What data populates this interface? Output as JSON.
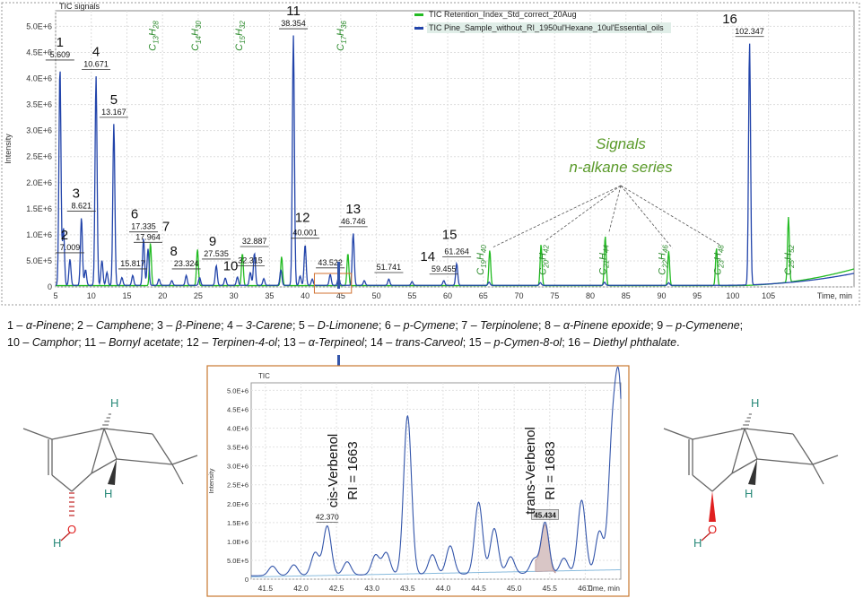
{
  "chart_data": [
    {
      "type": "line",
      "title": "TIC signals",
      "xlabel": "Time, min",
      "ylabel": "Intensity",
      "xlim": [
        5,
        117
      ],
      "ylim": [
        0,
        5300000
      ],
      "x_ticks": [
        "5",
        "10",
        "15",
        "20",
        "25",
        "30",
        "35",
        "40",
        "45",
        "50",
        "55",
        "60",
        "65",
        "70",
        "75",
        "80",
        "85",
        "90",
        "95",
        "100",
        "105"
      ],
      "y_ticks": [
        "0",
        "5.0E+5",
        "1.0E+6",
        "1.5E+6",
        "2.0E+6",
        "2.5E+6",
        "3.0E+6",
        "3.5E+6",
        "4.0E+6",
        "4.5E+6",
        "5.0E+6"
      ],
      "legend": {
        "position": "top-right",
        "entries": [
          {
            "name": "TIC Retention_Index_Std_correct_20Aug",
            "color": "#22bb22"
          },
          {
            "name": "TIC Pine_Sample_without_RI_1950ul'Hexane_10ul'Essential_oils",
            "color": "#2244aa"
          }
        ]
      },
      "series": [
        {
          "name": "TIC Pine_Sample_without_RI_1950ul'Hexane_10ul'Essential_oils",
          "color": "#2244aa",
          "peaks": [
            {
              "x": 5.609,
              "y": 4200000,
              "rt": "5.609",
              "num": "1"
            },
            {
              "x": 7.009,
              "y": 500000,
              "rt": "7.009",
              "num": "2"
            },
            {
              "x": 8.621,
              "y": 1300000,
              "rt": "8.621",
              "num": "3"
            },
            {
              "x": 10.671,
              "y": 4020000,
              "rt": "10.671",
              "num": "4"
            },
            {
              "x": 13.167,
              "y": 3100000,
              "rt": "13.167",
              "num": "5"
            },
            {
              "x": 15.817,
              "y": 190000,
              "rt": "15.817",
              "num": ""
            },
            {
              "x": 17.335,
              "y": 900000,
              "rt": "17.335",
              "num": "6"
            },
            {
              "x": 17.964,
              "y": 700000,
              "rt": "17.964",
              "num": "7"
            },
            {
              "x": 23.324,
              "y": 190000,
              "rt": "23.324",
              "num": "8"
            },
            {
              "x": 27.535,
              "y": 380000,
              "rt": "27.535",
              "num": "9"
            },
            {
              "x": 32.315,
              "y": 250000,
              "rt": "32.315",
              "num": "10"
            },
            {
              "x": 32.887,
              "y": 620000,
              "rt": "32.887",
              "num": ""
            },
            {
              "x": 38.354,
              "y": 4800000,
              "rt": "38.354",
              "num": "11"
            },
            {
              "x": 40.001,
              "y": 780000,
              "rt": "40.001",
              "num": "12"
            },
            {
              "x": 43.522,
              "y": 210000,
              "rt": "43.522",
              "num": ""
            },
            {
              "x": 46.746,
              "y": 1000000,
              "rt": "46.746",
              "num": "13"
            },
            {
              "x": 51.741,
              "y": 120000,
              "rt": "51.741",
              "num": ""
            },
            {
              "x": 59.455,
              "y": 90000,
              "rt": "59.455",
              "num": "14"
            },
            {
              "x": 61.264,
              "y": 420000,
              "rt": "61.264",
              "num": "15"
            },
            {
              "x": 102.347,
              "y": 4650000,
              "rt": "102.347",
              "num": "16"
            }
          ],
          "minor_peaks": [
            {
              "x": 6.1,
              "y": 1100000
            },
            {
              "x": 9.2,
              "y": 300000
            },
            {
              "x": 11.5,
              "y": 480000
            },
            {
              "x": 12.2,
              "y": 250000
            },
            {
              "x": 14.3,
              "y": 150000
            },
            {
              "x": 19.5,
              "y": 120000
            },
            {
              "x": 21.3,
              "y": 90000
            },
            {
              "x": 25.2,
              "y": 150000
            },
            {
              "x": 28.8,
              "y": 140000
            },
            {
              "x": 30.5,
              "y": 160000
            },
            {
              "x": 34.2,
              "y": 130000
            },
            {
              "x": 36.6,
              "y": 300000
            },
            {
              "x": 39.3,
              "y": 180000
            },
            {
              "x": 41.0,
              "y": 120000
            },
            {
              "x": 44.7,
              "y": 160000
            },
            {
              "x": 48.3,
              "y": 90000
            },
            {
              "x": 55.0,
              "y": 70000
            },
            {
              "x": 65.8,
              "y": 60000
            },
            {
              "x": 73.0,
              "y": 50000
            },
            {
              "x": 82.0,
              "y": 60000
            },
            {
              "x": 91.0,
              "y": 50000
            }
          ]
        },
        {
          "name": "TIC Retention_Index_Std_correct_20Aug",
          "color": "#22bb22",
          "peaks": [
            {
              "x": 18.3,
              "y": 820000
            },
            {
              "x": 24.9,
              "y": 700000
            },
            {
              "x": 31.2,
              "y": 620000
            },
            {
              "x": 36.7,
              "y": 560000
            },
            {
              "x": 46.0,
              "y": 620000
            },
            {
              "x": 65.9,
              "y": 680000
            },
            {
              "x": 73.1,
              "y": 790000
            },
            {
              "x": 82.1,
              "y": 950000
            },
            {
              "x": 91.0,
              "y": 660000
            },
            {
              "x": 97.7,
              "y": 720000
            },
            {
              "x": 107.8,
              "y": 1250000
            }
          ]
        }
      ],
      "alkane_labels": [
        {
          "x": 19.0,
          "text": "C13H28"
        },
        {
          "x": 25.0,
          "text": "C14H30"
        },
        {
          "x": 31.2,
          "text": "C15H32"
        },
        {
          "x": 45.4,
          "text": "C17H36"
        },
        {
          "x": 65.0,
          "text": "C19H40"
        },
        {
          "x": 73.8,
          "text": "C20H42"
        },
        {
          "x": 82.2,
          "text": "C21H44"
        },
        {
          "x": 90.5,
          "text": "C22H46"
        },
        {
          "x": 98.3,
          "text": "C23H48"
        },
        {
          "x": 108.2,
          "text": "C25H52"
        }
      ],
      "annotation": {
        "line1": "Signals",
        "line2": "n-alkane series"
      }
    },
    {
      "type": "line",
      "title": "TIC",
      "xlabel": "Time, min",
      "ylabel": "Intensity",
      "xlim": [
        41.3,
        46.5
      ],
      "ylim": [
        0,
        5200000
      ],
      "x_ticks": [
        "41.5",
        "42.0",
        "42.5",
        "43.0",
        "43.5",
        "44.0",
        "44.5",
        "45.0",
        "45.5",
        "46.0"
      ],
      "y_ticks": [
        "0",
        "5.0E+5",
        "1.0E+6",
        "1.5E+6",
        "2.0E+6",
        "2.5E+6",
        "3.0E+6",
        "3.5E+6",
        "4.0E+6",
        "4.5E+6",
        "5.0E+6"
      ],
      "peaks": [
        {
          "x": 41.6,
          "y": 250000
        },
        {
          "x": 41.9,
          "y": 280000
        },
        {
          "x": 42.2,
          "y": 600000
        },
        {
          "x": 42.37,
          "y": 1300000,
          "rt": "42.370"
        },
        {
          "x": 42.65,
          "y": 350000
        },
        {
          "x": 43.05,
          "y": 520000
        },
        {
          "x": 43.2,
          "y": 580000
        },
        {
          "x": 43.5,
          "y": 4200000
        },
        {
          "x": 43.85,
          "y": 520000
        },
        {
          "x": 44.1,
          "y": 750000
        },
        {
          "x": 44.5,
          "y": 1900000
        },
        {
          "x": 44.72,
          "y": 1200000
        },
        {
          "x": 44.95,
          "y": 450000
        },
        {
          "x": 45.28,
          "y": 380000
        },
        {
          "x": 45.434,
          "y": 1350000,
          "rt": "45.434"
        },
        {
          "x": 45.7,
          "y": 400000
        },
        {
          "x": 45.95,
          "y": 1930000
        },
        {
          "x": 46.2,
          "y": 1100000
        },
        {
          "x": 46.38,
          "y": 3300000
        },
        {
          "x": 46.48,
          "y": 4600000
        }
      ],
      "callouts": [
        {
          "name": "cis-Verbenol",
          "ri": "RI = 1663",
          "x": 42.37
        },
        {
          "name": "trans-Verbenol",
          "ri": "RI = 1683",
          "x": 45.434
        }
      ]
    }
  ],
  "caption": {
    "parts": [
      {
        "t": "1 – ",
        "i": false
      },
      {
        "t": "α-Pinene",
        "i": true
      },
      {
        "t": "; 2 – ",
        "i": false
      },
      {
        "t": "Camphene",
        "i": true
      },
      {
        "t": "; 3 – ",
        "i": false
      },
      {
        "t": "β-Pinene",
        "i": true
      },
      {
        "t": "; 4 – ",
        "i": false
      },
      {
        "t": "3-Carene",
        "i": true
      },
      {
        "t": "; 5 – ",
        "i": false
      },
      {
        "t": "D-Limonene",
        "i": true
      },
      {
        "t": "; 6 – ",
        "i": false
      },
      {
        "t": "p-Cymene",
        "i": true
      },
      {
        "t": "; 7 – ",
        "i": false
      },
      {
        "t": "Terpinolene",
        "i": true
      },
      {
        "t": "; 8 – ",
        "i": false
      },
      {
        "t": "α-Pinene epoxide",
        "i": true
      },
      {
        "t": "; 9 – ",
        "i": false
      },
      {
        "t": "p-Cymenene",
        "i": true
      },
      {
        "t": ";",
        "i": false
      },
      {
        "t": "10 – ",
        "i": false,
        "br": true
      },
      {
        "t": "Camphor",
        "i": true
      },
      {
        "t": "; 11 – ",
        "i": false
      },
      {
        "t": "Bornyl acetate",
        "i": true
      },
      {
        "t": "; 12 – ",
        "i": false
      },
      {
        "t": "Terpinen-4-ol",
        "i": true
      },
      {
        "t": "; 13 – ",
        "i": false
      },
      {
        "t": "α-Terpineol",
        "i": true
      },
      {
        "t": "; 14 – ",
        "i": false
      },
      {
        "t": "trans-Carveol",
        "i": true
      },
      {
        "t": "; 15 – ",
        "i": false
      },
      {
        "t": "p-Cymen-8-ol",
        "i": true
      },
      {
        "t": "; 16 – ",
        "i": false
      },
      {
        "t": "Diethyl phthalate",
        "i": true
      },
      {
        "t": ".",
        "i": false
      }
    ]
  },
  "molecules": [
    {
      "h_top": "H",
      "h_bottom": "H",
      "o": "O",
      "h_o": "H"
    },
    {
      "h_top": "H",
      "h_bottom": "H",
      "o": "O",
      "h_o": "H"
    }
  ]
}
